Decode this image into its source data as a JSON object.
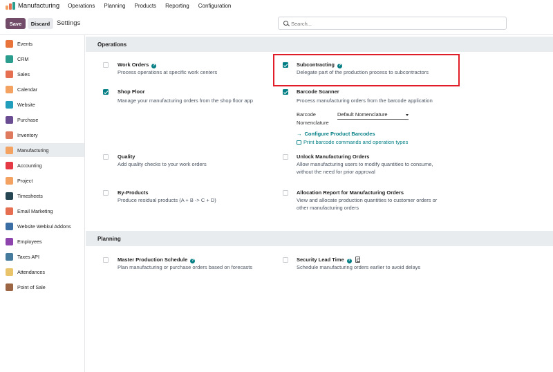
{
  "topnav": {
    "app_name": "Manufacturing",
    "menu": [
      "Operations",
      "Planning",
      "Products",
      "Reporting",
      "Configuration"
    ]
  },
  "control": {
    "save_label": "Save",
    "discard_label": "Discard",
    "title": "Settings",
    "search_placeholder": "Search..."
  },
  "sidebar": {
    "items": [
      {
        "label": "Events",
        "color": "#e8743b"
      },
      {
        "label": "CRM",
        "color": "#2a9d8f"
      },
      {
        "label": "Sales",
        "color": "#e76f51"
      },
      {
        "label": "Calendar",
        "color": "#f4a261"
      },
      {
        "label": "Website",
        "color": "#219ebc"
      },
      {
        "label": "Purchase",
        "color": "#6a4c93"
      },
      {
        "label": "Inventory",
        "color": "#e07a5f"
      },
      {
        "label": "Manufacturing",
        "color": "#f4a261"
      },
      {
        "label": "Accounting",
        "color": "#e63946"
      },
      {
        "label": "Project",
        "color": "#f4a261"
      },
      {
        "label": "Timesheets",
        "color": "#264653"
      },
      {
        "label": "Email Marketing",
        "color": "#e76f51"
      },
      {
        "label": "Website Webkul Addons",
        "color": "#3a6ea5"
      },
      {
        "label": "Employees",
        "color": "#8e44ad"
      },
      {
        "label": "Taxes API",
        "color": "#457b9d"
      },
      {
        "label": "Attendances",
        "color": "#e9c46a"
      },
      {
        "label": "Point of Sale",
        "color": "#9c6644"
      }
    ],
    "active_index": 7
  },
  "sections": {
    "operations": "Operations",
    "planning": "Planning"
  },
  "settings": {
    "work_orders": {
      "title": "Work Orders",
      "desc": "Process operations at specific work centers",
      "checked": false
    },
    "subcontracting": {
      "title": "Subcontracting",
      "desc": "Delegate part of the production process to subcontractors",
      "checked": true
    },
    "shop_floor": {
      "title": "Shop Floor",
      "desc": "Manage your manufacturing orders from the shop floor app",
      "checked": true
    },
    "barcode_scanner": {
      "title": "Barcode Scanner",
      "desc": "Process manufacturing orders from the barcode application",
      "checked": true,
      "nomenclature_label_1": "Barcode",
      "nomenclature_label_2": "Nomenclature",
      "nomenclature_value": "Default Nomenclature",
      "configure_link": "Configure Product Barcodes",
      "print_link": "Print barcode commands and operation types"
    },
    "quality": {
      "title": "Quality",
      "desc": "Add quality checks to your work orders",
      "checked": false
    },
    "unlock_mo": {
      "title": "Unlock Manufacturing Orders",
      "desc_1": "Allow manufacturing users to modify quantities to consume,",
      "desc_2": "without the need for prior approval",
      "checked": false
    },
    "by_products": {
      "title": "By-Products",
      "desc": "Produce residual products (A + B -> C + D)",
      "checked": false
    },
    "allocation_report": {
      "title": "Allocation Report for Manufacturing Orders",
      "desc_1": "View and allocate production quantities to customer orders or",
      "desc_2": "other manufacturing orders",
      "checked": false
    },
    "mps": {
      "title": "Master Production Schedule",
      "desc": "Plan manufacturing or purchase orders based on forecasts",
      "checked": false
    },
    "security_lead_time": {
      "title": "Security Lead Time",
      "desc": "Schedule manufacturing orders earlier to avoid delays",
      "checked": false
    }
  },
  "colors": {
    "brand": "#714b67",
    "accent": "#017e84",
    "highlight": "#e11d2a"
  }
}
